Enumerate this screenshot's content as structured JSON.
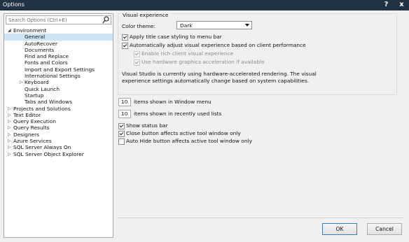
{
  "window": {
    "title": "Options",
    "help_glyph": "?",
    "close_glyph": "x"
  },
  "search": {
    "placeholder": "Search Options (Ctrl+E)",
    "value": ""
  },
  "tree": {
    "environment": {
      "label": "Environment",
      "expanded": true
    },
    "env_children": [
      "General",
      "AutoRecover",
      "Documents",
      "Find and Replace",
      "Fonts and Colors",
      "Import and Export Settings",
      "International Settings",
      "Keyboard",
      "Quick Launch",
      "Startup",
      "Tabs and Windows"
    ],
    "selected": "General",
    "root_items": [
      "Projects and Solutions",
      "Text Editor",
      "Query Execution",
      "Query Results",
      "Designers",
      "Azure Services",
      "SQL Server Always On",
      "SQL Server Object Explorer"
    ]
  },
  "visual_experience": {
    "group_title": "Visual experience",
    "color_theme_label": "Color theme:",
    "color_theme_value": "Dark",
    "apply_title_case": {
      "label": "Apply title case styling to menu bar",
      "checked": true
    },
    "auto_adjust": {
      "label": "Automatically adjust visual experience based on client performance",
      "checked": true
    },
    "rich_client": {
      "label": "Enable rich client visual experience",
      "checked": true,
      "enabled": false
    },
    "hw_accel": {
      "label": "Use hardware graphics acceleration if available",
      "checked": true,
      "enabled": false
    },
    "info_line1": "Visual Studio is currently using hardware-accelerated rendering. The visual",
    "info_line2": "experience settings automatically change based on system capabilities."
  },
  "window_menu": {
    "value": "10",
    "label": "items shown in Window menu"
  },
  "recent_lists": {
    "value": "10",
    "label": "items shown in recently used lists"
  },
  "show_status_bar": {
    "label": "Show status bar",
    "checked": true
  },
  "close_button": {
    "label": "Close button affects active tool window only",
    "checked": true
  },
  "auto_hide": {
    "label": "Auto Hide button affects active tool window only",
    "checked": false
  },
  "buttons": {
    "ok": "OK",
    "cancel": "Cancel"
  },
  "colors": {
    "titlebar": "#223245",
    "selection": "#cde3f6",
    "dialog_bg": "#f0f0f0"
  }
}
